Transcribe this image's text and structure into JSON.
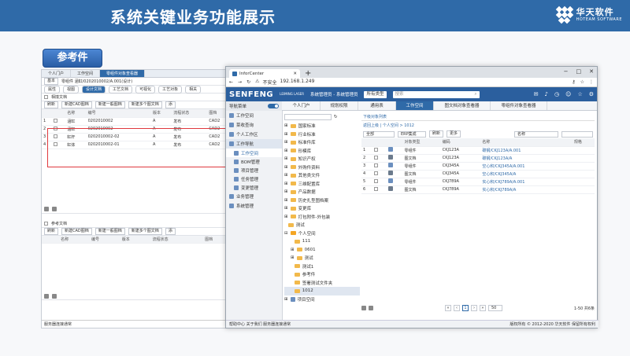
{
  "slide": {
    "title": "系统关键业务功能展示",
    "logo_cn": "华天软件",
    "logo_en": "HOTEAM SOFTWARE",
    "ref_label": "参考件"
  },
  "back_window": {
    "top_tabs": [
      "个人门户",
      "工作空间",
      "零组件对象查看器"
    ],
    "toolbar_label": "基本",
    "object_path": "零组件 涵缸/0202010002/A.001(设计)",
    "sub_tabs": [
      "属性",
      "视图",
      "设计文档",
      "工艺文档",
      "可视化",
      "工艺对象",
      "相关"
    ],
    "section1_title": "相撞文档",
    "section2_title": "参考文档",
    "buttons": [
      "刷新",
      "新建CAD图档",
      "新建一般图档",
      "新建多个图文档",
      "添"
    ],
    "columns": [
      "",
      "",
      "名称",
      "编号",
      "版本",
      "流程状态",
      "图档"
    ],
    "rows": [
      {
        "idx": "1",
        "name": "涵缸",
        "code": "0202010002",
        "ver": "A",
        "status": "发布",
        "type": "CAD2"
      },
      {
        "idx": "2",
        "name": "涵缸",
        "code": "0202010002",
        "ver": "A",
        "status": "发布",
        "type": "CAD2"
      },
      {
        "idx": "3",
        "name": "缸杆",
        "code": "0202010002-02",
        "ver": "A",
        "status": "发布",
        "type": "CAD2"
      },
      {
        "idx": "4",
        "name": "缸体",
        "code": "0202010002-01",
        "ver": "A",
        "status": "发布",
        "type": "CAD2"
      }
    ],
    "footer": "服务器连接通常"
  },
  "browser": {
    "tab_title": "InforCenter",
    "url_insecure": "不安全",
    "url": "192.168.1.249",
    "brand": "SENFENG",
    "brand_sub": "LEIMING LASER",
    "system_label": "系统管理员 - 系统管理员",
    "type_select": "所有类型",
    "search_placeholder": "搜索",
    "nav_tabs": [
      "个人门户",
      "规划权限",
      "通用表",
      "工作空间",
      "图文档对象查看器",
      "零组件对象查看器"
    ],
    "sidebar_header": "导航菜单",
    "sidebar_items": [
      {
        "label": "工作空间",
        "sub": false
      },
      {
        "label": "菜收查询",
        "sub": false
      },
      {
        "label": "个人工作区",
        "sub": false
      },
      {
        "label": "工作导航",
        "sub": false
      },
      {
        "label": "工作空间",
        "sub": true
      },
      {
        "label": "BOM管理",
        "sub": true
      },
      {
        "label": "项目管理",
        "sub": true
      },
      {
        "label": "任务管理",
        "sub": true
      },
      {
        "label": "变更管理",
        "sub": true
      },
      {
        "label": "业务管理",
        "sub": false
      },
      {
        "label": "系统管理",
        "sub": false
      }
    ],
    "tree_items": [
      "国家标准",
      "行业标准",
      "标准件库",
      "形模库",
      "知识产权",
      "外购件资料",
      "其他类文件",
      "三维配置库",
      "产品数据",
      "历史扎型图档案",
      "变更库",
      "打包附件-外包装",
      "测试",
      "个人空间",
      "111",
      "0601",
      "测试",
      "测试1",
      "参考件",
      "签署测试文件夹",
      "1012",
      "项目空间"
    ],
    "breadcrumb_tab": "下级对象列表",
    "breadcrumb": "返回上级 | 个人空间 > 1012",
    "filter_all": "全部",
    "filter_type": "ERP集成",
    "refresh": "刷新",
    "more": "更多",
    "name_placeholder": "名称",
    "columns": [
      "",
      "",
      "",
      "对象类型",
      "编码",
      "名称",
      "规格"
    ],
    "rows": [
      {
        "idx": "1",
        "type": "零组件",
        "code": "CKJ123A",
        "name": "碳钢/CKJ123A/A.001"
      },
      {
        "idx": "2",
        "type": "图文档",
        "code": "CKJ123A",
        "name": "碳钢/CKJ123A/A"
      },
      {
        "idx": "3",
        "type": "零组件",
        "code": "CKJ345A",
        "name": "空心积/CKJ345A/A.001"
      },
      {
        "idx": "4",
        "type": "图文档",
        "code": "CKJ345A",
        "name": "空心积/CKJ345A/A"
      },
      {
        "idx": "5",
        "type": "零组件",
        "code": "CKJ789A",
        "name": "实心积/CKJ789A/A.001"
      },
      {
        "idx": "6",
        "type": "图文档",
        "code": "CKJ789A",
        "name": "实心积/CKJ789A/A"
      }
    ],
    "page_current": "1",
    "page_size": "50",
    "page_summary": "1-50 共6条",
    "footer_left": "帮助中心  关于我们  服务器连接通常",
    "footer_right": "版权所有 © 2012-2020 华天软件 保留所有权利"
  }
}
